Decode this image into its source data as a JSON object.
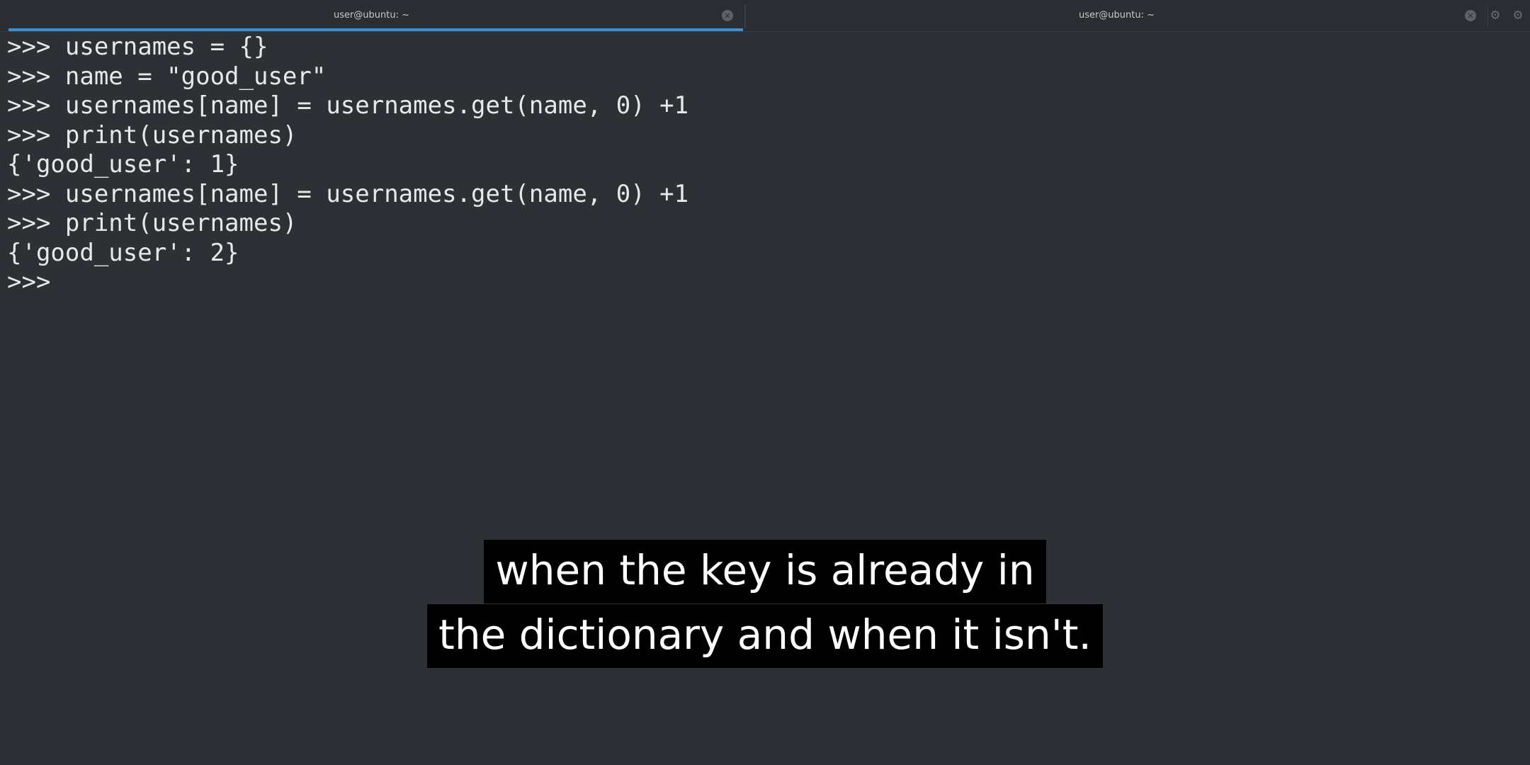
{
  "tabs": [
    {
      "title": "user@ubuntu: ~",
      "active": true
    },
    {
      "title": "user@ubuntu: ~",
      "active": false
    }
  ],
  "toolbar": {
    "close_glyph": "×",
    "settings_glyph": "⚙",
    "menu_glyph": "⚙"
  },
  "terminal": {
    "lines": [
      ">>> usernames = {}",
      ">>> name = \"good_user\"",
      ">>> usernames[name] = usernames.get(name, 0) +1",
      ">>> print(usernames)",
      "{'good_user': 1}",
      ">>> usernames[name] = usernames.get(name, 0) +1",
      ">>> print(usernames)",
      "{'good_user': 2}",
      ">>>"
    ]
  },
  "subtitle": {
    "line1": "when the key is already in",
    "line2": "the dictionary and when it isn't."
  },
  "colors": {
    "background": "#2d3035",
    "tab_active_accent": "#3b8ed0",
    "text": "#e8e8e8"
  }
}
